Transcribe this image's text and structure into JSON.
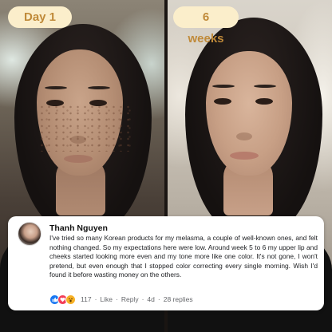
{
  "labels": {
    "before": "Day 1",
    "after": "6 weeks"
  },
  "comment": {
    "author": "Thanh Nguyen",
    "text": "I've tried so many Korean products for my melasma, a couple of well-known ones, and felt nothing changed. So my expectations here were low. Around week 5 to 6 my upper lip and cheeks started looking more even and my tone more like one color. It's not gone, I won't pretend, but even enough that I stopped color correcting every single morning. Wish I'd found it before wasting money on the others.",
    "reactions": [
      "like-icon",
      "love-icon",
      "wow-icon"
    ],
    "reaction_count": "117",
    "like_label": "Like",
    "reply_label": "Reply",
    "time": "4d",
    "replies_label": "28 replies"
  },
  "colors": {
    "label_bg": "#fbeecb",
    "label_text": "#c08a39",
    "like_blue": "#1877f2",
    "love_red": "#f33e58",
    "wow_yellow": "#f7b125"
  }
}
